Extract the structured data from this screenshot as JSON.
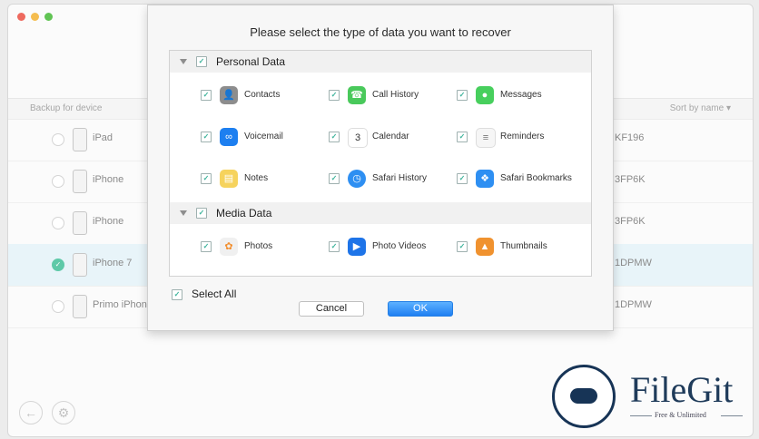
{
  "main": {
    "list_header_left": "Backup for device",
    "list_header_right": "Sort by name ▾",
    "devices": [
      {
        "name": "iPad",
        "serial": "KF196",
        "selected": false
      },
      {
        "name": "iPhone",
        "serial": "3FP6K",
        "selected": false
      },
      {
        "name": "iPhone",
        "serial": "3FP6K",
        "selected": false
      },
      {
        "name": "iPhone 7",
        "serial": "1DPMW",
        "selected": true
      },
      {
        "name": "Primo iPhone",
        "serial": "1DPMW",
        "selected": false
      }
    ]
  },
  "dialog": {
    "title": "Please select the type of data you want to recover",
    "sections": [
      {
        "label": "Personal Data",
        "items": [
          {
            "label": "Contacts",
            "icon": "contacts-icon",
            "color": "#8d8d8d"
          },
          {
            "label": "Call History",
            "icon": "phone-icon",
            "color": "#49c95b"
          },
          {
            "label": "Messages",
            "icon": "messages-icon",
            "color": "#47cf5d"
          },
          {
            "label": "Voicemail",
            "icon": "voicemail-icon",
            "color": "#1d7ff0"
          },
          {
            "label": "Calendar",
            "icon": "calendar-icon",
            "color": "#ffffff"
          },
          {
            "label": "Reminders",
            "icon": "reminders-icon",
            "color": "#f6f6f6"
          },
          {
            "label": "Notes",
            "icon": "notes-icon",
            "color": "#f6d35d"
          },
          {
            "label": "Safari History",
            "icon": "safari-history-icon",
            "color": "#2e8ff2"
          },
          {
            "label": "Safari Bookmarks",
            "icon": "safari-bookmarks-icon",
            "color": "#2e8ff2"
          }
        ]
      },
      {
        "label": "Media Data",
        "items": [
          {
            "label": "Photos",
            "icon": "photos-icon",
            "color": "#f0f0f0"
          },
          {
            "label": "Photo Videos",
            "icon": "photo-videos-icon",
            "color": "#1e74e8"
          },
          {
            "label": "Thumbnails",
            "icon": "thumbnails-icon",
            "color": "#f0922f"
          }
        ]
      }
    ],
    "select_all_label": "Select All",
    "cancel_label": "Cancel",
    "ok_label": "OK"
  },
  "watermark": {
    "brand": "FileGit",
    "tagline": "Free & Unlimited"
  }
}
